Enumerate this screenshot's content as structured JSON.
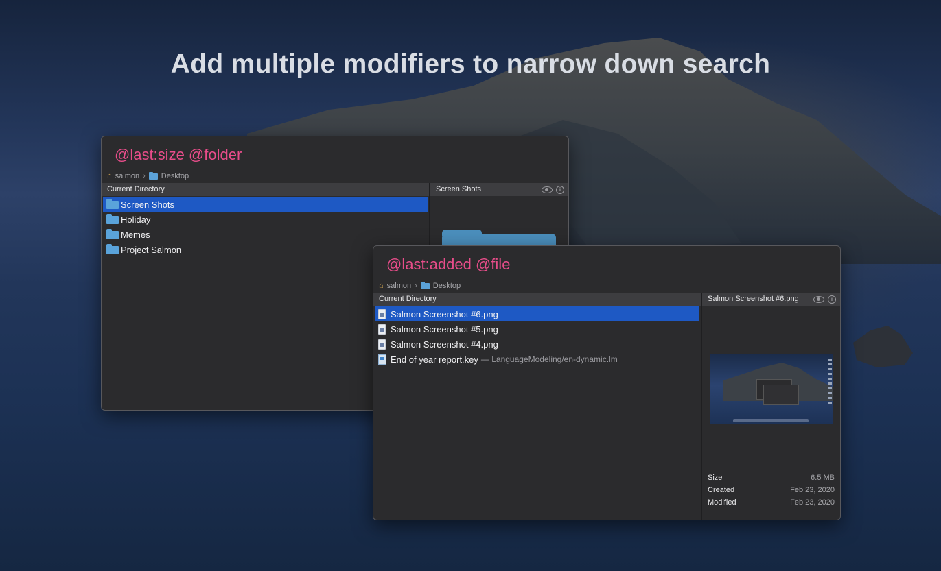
{
  "headline": "Add multiple modifiers to narrow down search",
  "window1": {
    "query": "@last:size @folder",
    "breadcrumb": {
      "home": "salmon",
      "folder": "Desktop"
    },
    "list_header": "Current Directory",
    "preview_header": "Screen Shots",
    "items": [
      {
        "label": "Screen Shots",
        "selected": true
      },
      {
        "label": "Holiday",
        "selected": false
      },
      {
        "label": "Memes",
        "selected": false
      },
      {
        "label": "Project Salmon",
        "selected": false
      }
    ]
  },
  "window2": {
    "query": "@last:added @file",
    "breadcrumb": {
      "home": "salmon",
      "folder": "Desktop"
    },
    "list_header": "Current Directory",
    "preview_header": "Salmon Screenshot #6.png",
    "items": [
      {
        "label": "Salmon Screenshot #6.png",
        "selected": true
      },
      {
        "label": "Salmon Screenshot #5.png",
        "selected": false
      },
      {
        "label": "Salmon Screenshot #4.png",
        "selected": false
      },
      {
        "label": "End of year report.key",
        "path": "— LanguageModeling/en-dynamic.lm",
        "selected": false
      }
    ],
    "metadata": [
      {
        "key": "Size",
        "value": "6.5 MB"
      },
      {
        "key": "Created",
        "value": "Feb 23, 2020"
      },
      {
        "key": "Modified",
        "value": "Feb 23, 2020"
      }
    ]
  },
  "colors": {
    "query": "#e84d8a",
    "selection": "#1e59c4",
    "folder": "#5aa3da",
    "panel": "#2b2b2d"
  }
}
